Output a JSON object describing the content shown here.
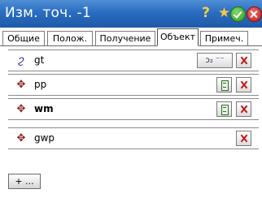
{
  "window": {
    "title": "Изм. точ. -1",
    "icons": [
      "help-icon",
      "favorite-icon",
      "ok-icon",
      "close-icon"
    ]
  },
  "tabs": [
    {
      "label": "Общие",
      "active": false
    },
    {
      "label": "Полож.",
      "active": false
    },
    {
      "label": "Получение",
      "active": false
    },
    {
      "label": "Объект",
      "active": true
    },
    {
      "label": "Примеч.",
      "active": false
    }
  ],
  "objects": [
    {
      "name": "gt",
      "icon": "line-feature-icon",
      "bold": false
    },
    {
      "name": "pp",
      "icon": "point-feature-icon",
      "bold": false
    },
    {
      "name": "wm",
      "icon": "point-feature-icon",
      "bold": true
    },
    {
      "name": "gwp",
      "icon": "point-feature-icon",
      "bold": false
    }
  ],
  "line_button_label": "ͻ₂ ⁻⁻",
  "add_button": {
    "label": "+ ..."
  },
  "colors": {
    "titlebar": "#2a6cc0",
    "delete": "#c01818",
    "accent": "#2e6b2a"
  }
}
